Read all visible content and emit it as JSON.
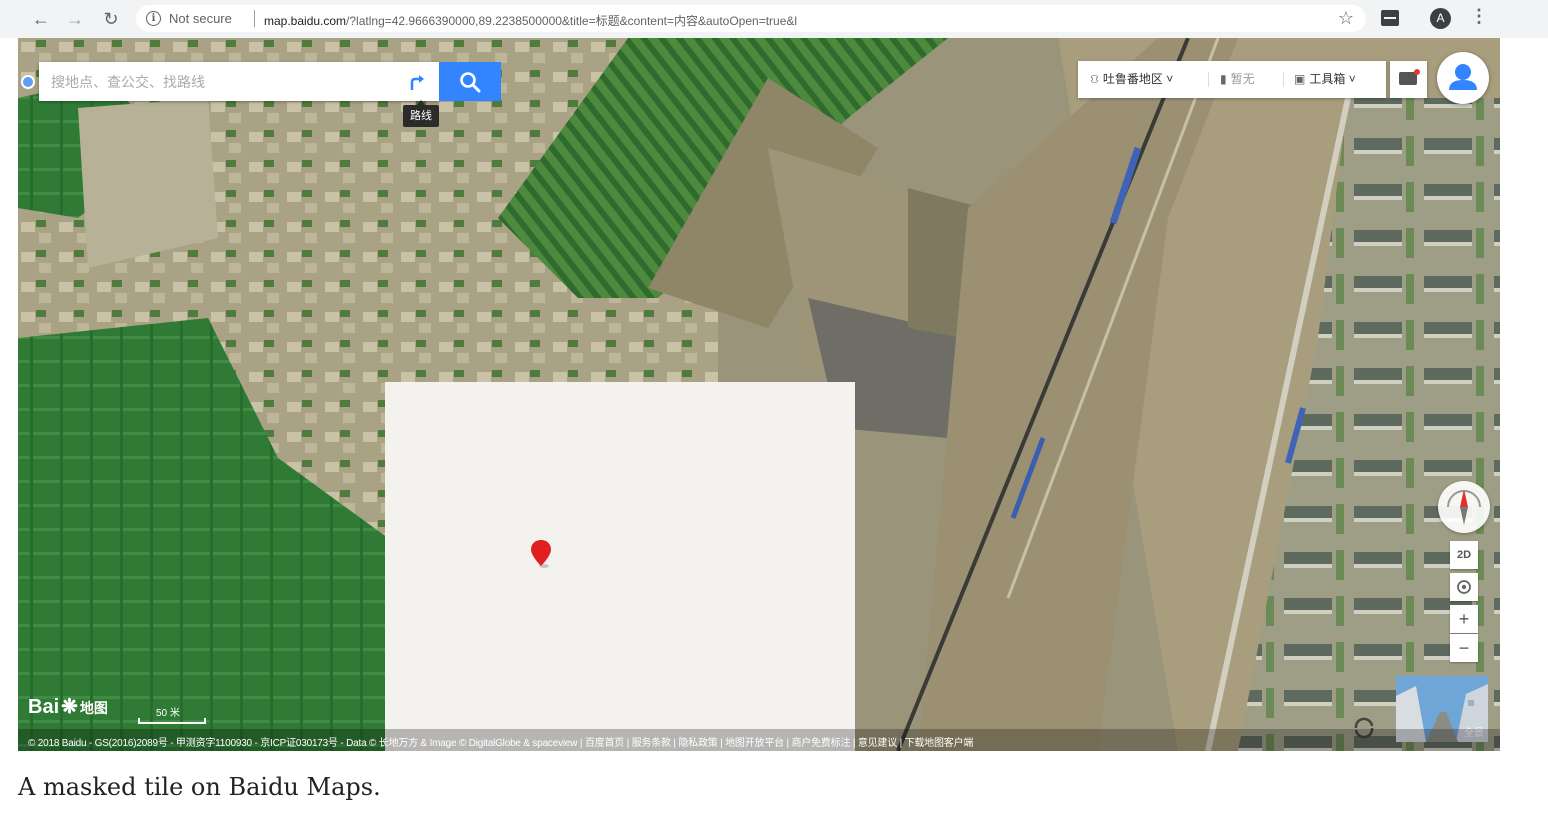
{
  "browser": {
    "security_label": "Not secure",
    "url_host": "map.baidu.com",
    "url_path": "/?latlng=42.9666390000,89.2238500000&title=标题&content=内容&autoOpen=true&l",
    "profile_initial": "A",
    "icons": [
      "back-arrow-icon",
      "forward-arrow-icon",
      "reload-icon",
      "info-icon",
      "star-icon",
      "extension-icon",
      "profile-icon",
      "menu-icon"
    ]
  },
  "map": {
    "search": {
      "placeholder": "搜地点、查公交、找路线",
      "route_tooltip": "路线"
    },
    "toolbar": {
      "region": "吐鲁番地区",
      "weather": "暂无",
      "toolbox": "工具箱"
    },
    "controls": {
      "view_mode": "2D",
      "zoom_in": "+",
      "zoom_out": "−",
      "panorama_label": "全景"
    },
    "logo": {
      "bai": "Bai",
      "map_text": "地图"
    },
    "scale": "50 米",
    "attribution": "© 2018 Baidu - GS(2016)2089号 - 甲测资字1100930 - 京ICP证030173号 - Data © 长地万方 & Image © DigitalGlobe & spaceview | 百度首页 | 服务条款 | 隐私政策 | 地图开放平台 | 商户免费标注 | 意见建议 | 下载地图客户端",
    "colors": {
      "accent": "#3385ff",
      "pin": "#e02020",
      "masked_tile": "#f3f2ef"
    }
  },
  "caption": "A masked tile on Baidu Maps."
}
